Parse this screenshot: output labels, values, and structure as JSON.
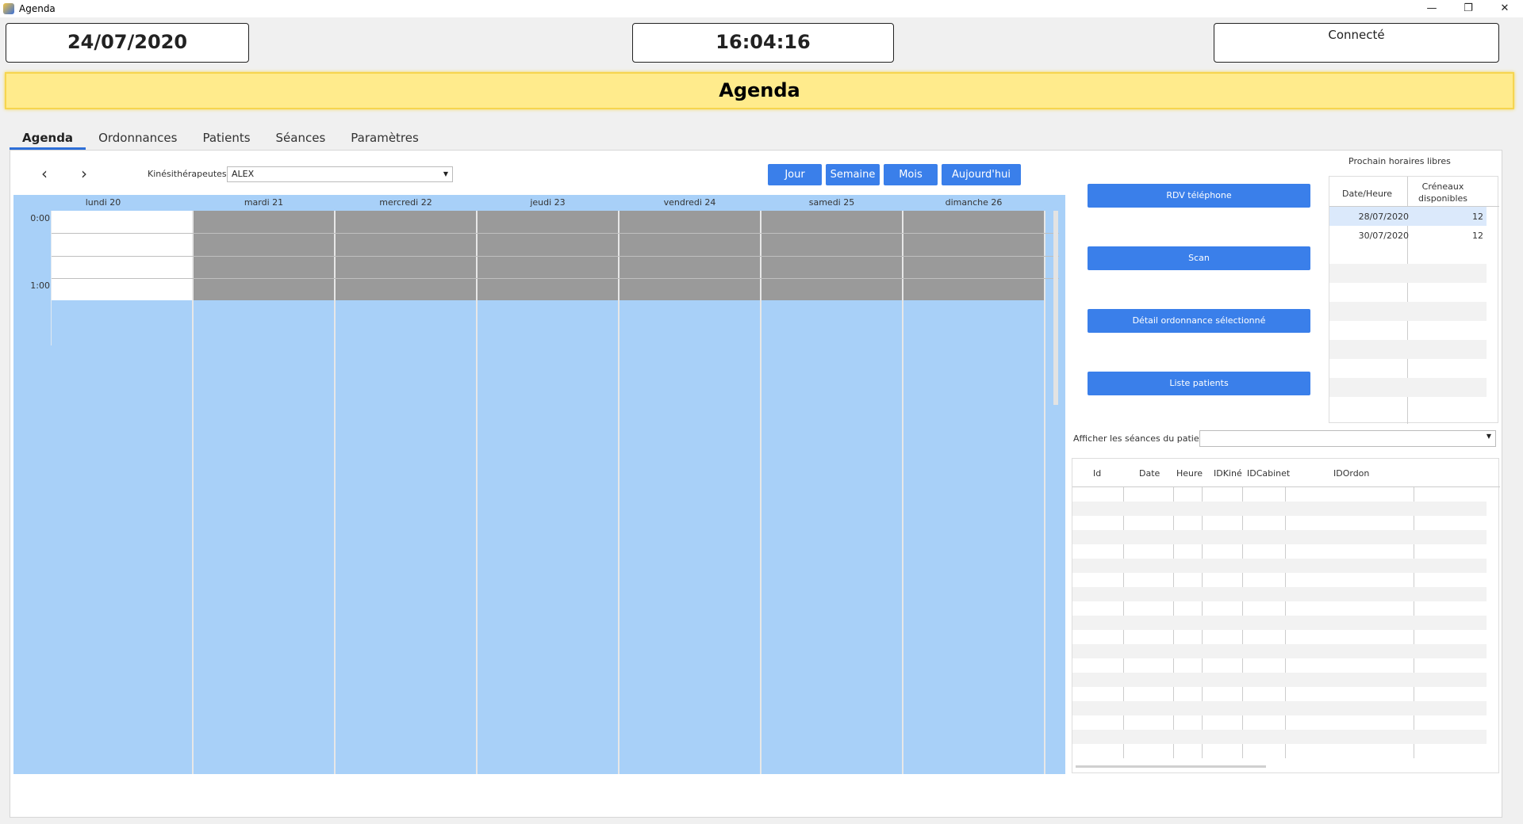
{
  "window": {
    "title": "Agenda",
    "controls": [
      "—",
      "❐",
      "✕"
    ]
  },
  "header": {
    "date": "24/07/2020",
    "time": "16:04:16",
    "status": "Connecté"
  },
  "banner": {
    "title": "Agenda"
  },
  "tabs": [
    {
      "label": "Agenda",
      "active": true
    },
    {
      "label": "Ordonnances"
    },
    {
      "label": "Patients"
    },
    {
      "label": "Séances"
    },
    {
      "label": "Paramètres"
    }
  ],
  "toolbar": {
    "prev": "‹",
    "next": "›",
    "kine_label": "Kinésithérapeutes",
    "kine_value": "ALEX",
    "views": [
      "Jour",
      "Semaine",
      "Mois",
      "Aujourd'hui"
    ]
  },
  "calendar": {
    "days": [
      "lundi 20",
      "mardi 21",
      "mercredi 22",
      "jeudi 23",
      "vendredi 24",
      "samedi 25",
      "dimanche 26"
    ],
    "times": [
      "0:00",
      "1:00"
    ]
  },
  "actions": [
    "RDV téléphone",
    "Scan",
    "Détail ordonnance sélectionné",
    "Liste patients"
  ],
  "free_slots": {
    "title": "Prochain horaires libres",
    "headers": [
      "Date/Heure",
      "Créneaux disponibles"
    ],
    "rows": [
      {
        "date": "28/07/2020",
        "count": "12"
      },
      {
        "date": "30/07/2020",
        "count": "12"
      }
    ]
  },
  "sessions": {
    "filter_label": "Afficher les séances du patient",
    "headers": [
      "Id",
      "Date",
      "Heure",
      "IDKiné",
      "IDCabinet",
      "IDOrdon"
    ]
  },
  "colors": {
    "accent": "#3a7fea",
    "banner": "#ffeb8c",
    "calendar_bg": "#a8d0f8",
    "blocked": "#9a9a9a"
  }
}
